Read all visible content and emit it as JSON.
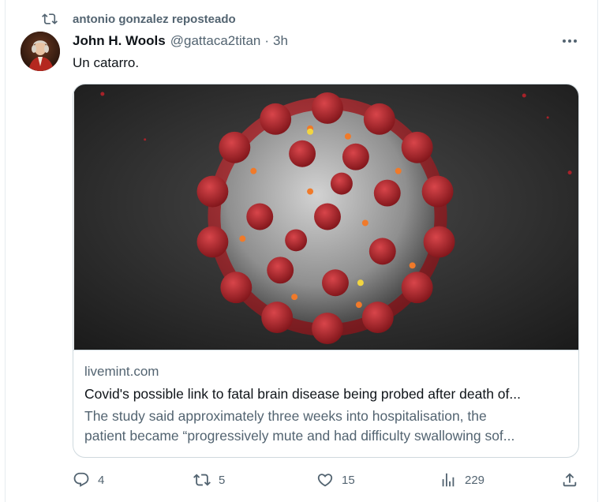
{
  "repost": {
    "icon": "repost-icon",
    "label": "antonio gonzalez reposteado"
  },
  "author": {
    "name": "John H. Wools",
    "handle": "@gattaca2titan",
    "separator": "·",
    "time": "3h",
    "avatar_icon": "avatar-portrait"
  },
  "tweet": {
    "text": "Un catarro."
  },
  "card": {
    "domain": "livemint.com",
    "title": "Covid's possible link to fatal brain disease being probed after death of...",
    "description_line1": "The study said approximately three weeks into hospitalisation, the",
    "description_line2": "patient became “progressively mute and had difficulty swallowing sof..."
  },
  "actions": {
    "replies": "4",
    "reposts": "5",
    "likes": "15",
    "views": "229"
  },
  "colors": {
    "text": "#0f1419",
    "secondary": "#536471",
    "border": "#cfd9de",
    "virus_spike": "#a8232a"
  }
}
